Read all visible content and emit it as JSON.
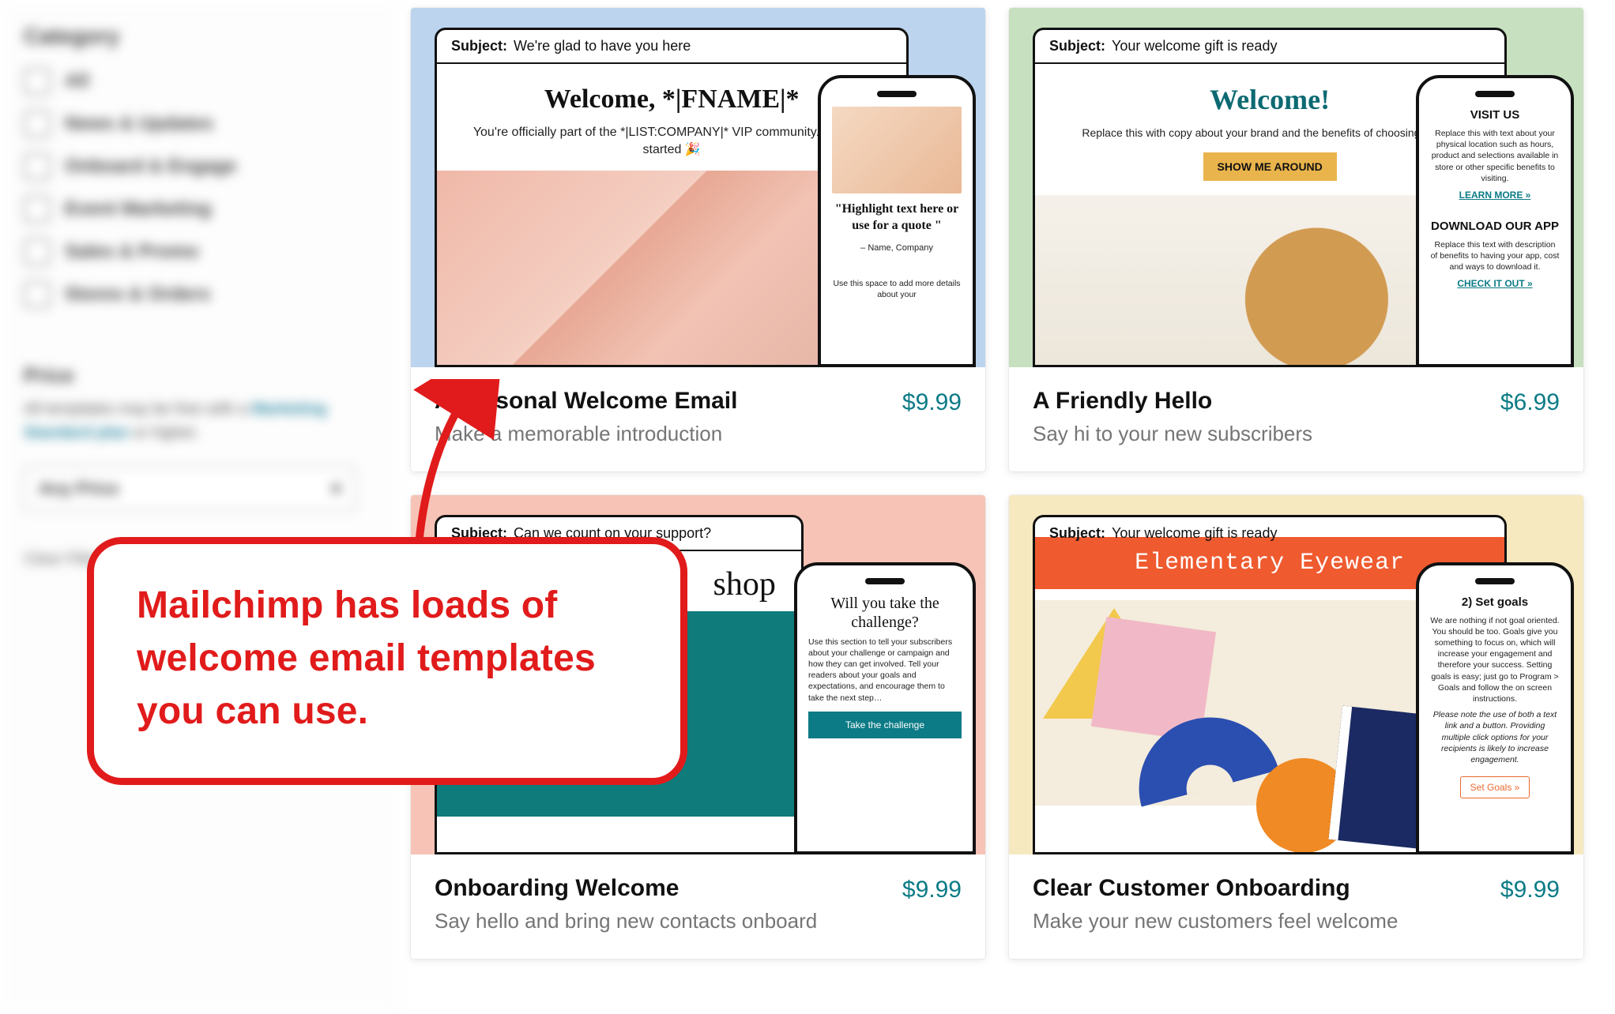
{
  "sidebar": {
    "category_heading": "Category",
    "filters": [
      {
        "label": "All"
      },
      {
        "label": "News & Updates"
      },
      {
        "label": "Onboard & Engage"
      },
      {
        "label": "Event Marketing"
      },
      {
        "label": "Sales & Promo"
      },
      {
        "label": "Stores & Orders"
      }
    ],
    "price_heading": "Price",
    "price_desc_prefix": "All templates may be free with a ",
    "price_desc_link": "Marketing Standard plan",
    "price_desc_suffix": " or higher.",
    "select_label": "Any Price",
    "clear_label": "Clear Filters"
  },
  "cards": [
    {
      "subject_label": "Subject:",
      "subject_text": "We're glad to have you here",
      "headline": "Welcome, *|FNAME|*",
      "subline": "You're officially part of the *|LIST:COMPANY|* VIP community. Let's get started 🎉",
      "phone": {
        "quote": "\"Highlight text here or use for a quote \"",
        "author": "– Name, Company",
        "note": "Use this space to add more details about your"
      },
      "title": "A Personal Welcome Email",
      "desc": "Make a memorable introduction",
      "price": "$9.99"
    },
    {
      "subject_label": "Subject:",
      "subject_text": "Your welcome gift is ready",
      "headline": "Welcome!",
      "subline": "Replace this with copy about your brand and the benefits of choosing your br",
      "cta": "SHOW ME AROUND",
      "phone": {
        "visit_h": "VISIT US",
        "visit_body": "Replace this with text about your physical location such as hours, product and selections available in store or other specific benefits to visiting.",
        "learn": "LEARN MORE »",
        "dl_h": "DOWNLOAD OUR APP",
        "dl_body": "Replace this text with description of benefits to having your app, cost and ways to download it.",
        "check": "CHECK IT OUT »"
      },
      "title": "A Friendly Hello",
      "desc": "Say hi to your new subscribers",
      "price": "$6.99"
    },
    {
      "subject_label": "Subject:",
      "subject_text": "Can we count on your support?",
      "shop_word": "shop",
      "phone": {
        "q_h": "Will you take the challenge?",
        "q_body": "Use this section to tell your subscribers about your challenge or campaign and how they can get involved. Tell your readers about your goals and expectations, and encourage them to take the next step…",
        "btn": "Take the challenge"
      },
      "title": "Onboarding Welcome",
      "desc": "Say hello and bring new contacts onboard",
      "price": "$9.99"
    },
    {
      "subject_label": "Subject:",
      "subject_text": "Your welcome gift is ready",
      "banner": "Elementary Eyewear",
      "phone": {
        "goals_h": "2) Set goals",
        "goals_body": "We are nothing if not goal oriented. You should be too. Goals give you something to focus on, which will increase your engagement and therefore your success. Setting goals is easy; just go to Program > Goals and follow the on screen instructions.",
        "goals_note": "Please note the use of both a text link and a button. Providing multiple click options for your recipients is likely to increase engagement.",
        "btn": "Set Goals »"
      },
      "title": "Clear Customer Onboarding",
      "desc": "Make your new customers feel welcome",
      "price": "$9.99"
    }
  ],
  "annotation": {
    "text": "Mailchimp has loads of welcome email templates you can use."
  }
}
